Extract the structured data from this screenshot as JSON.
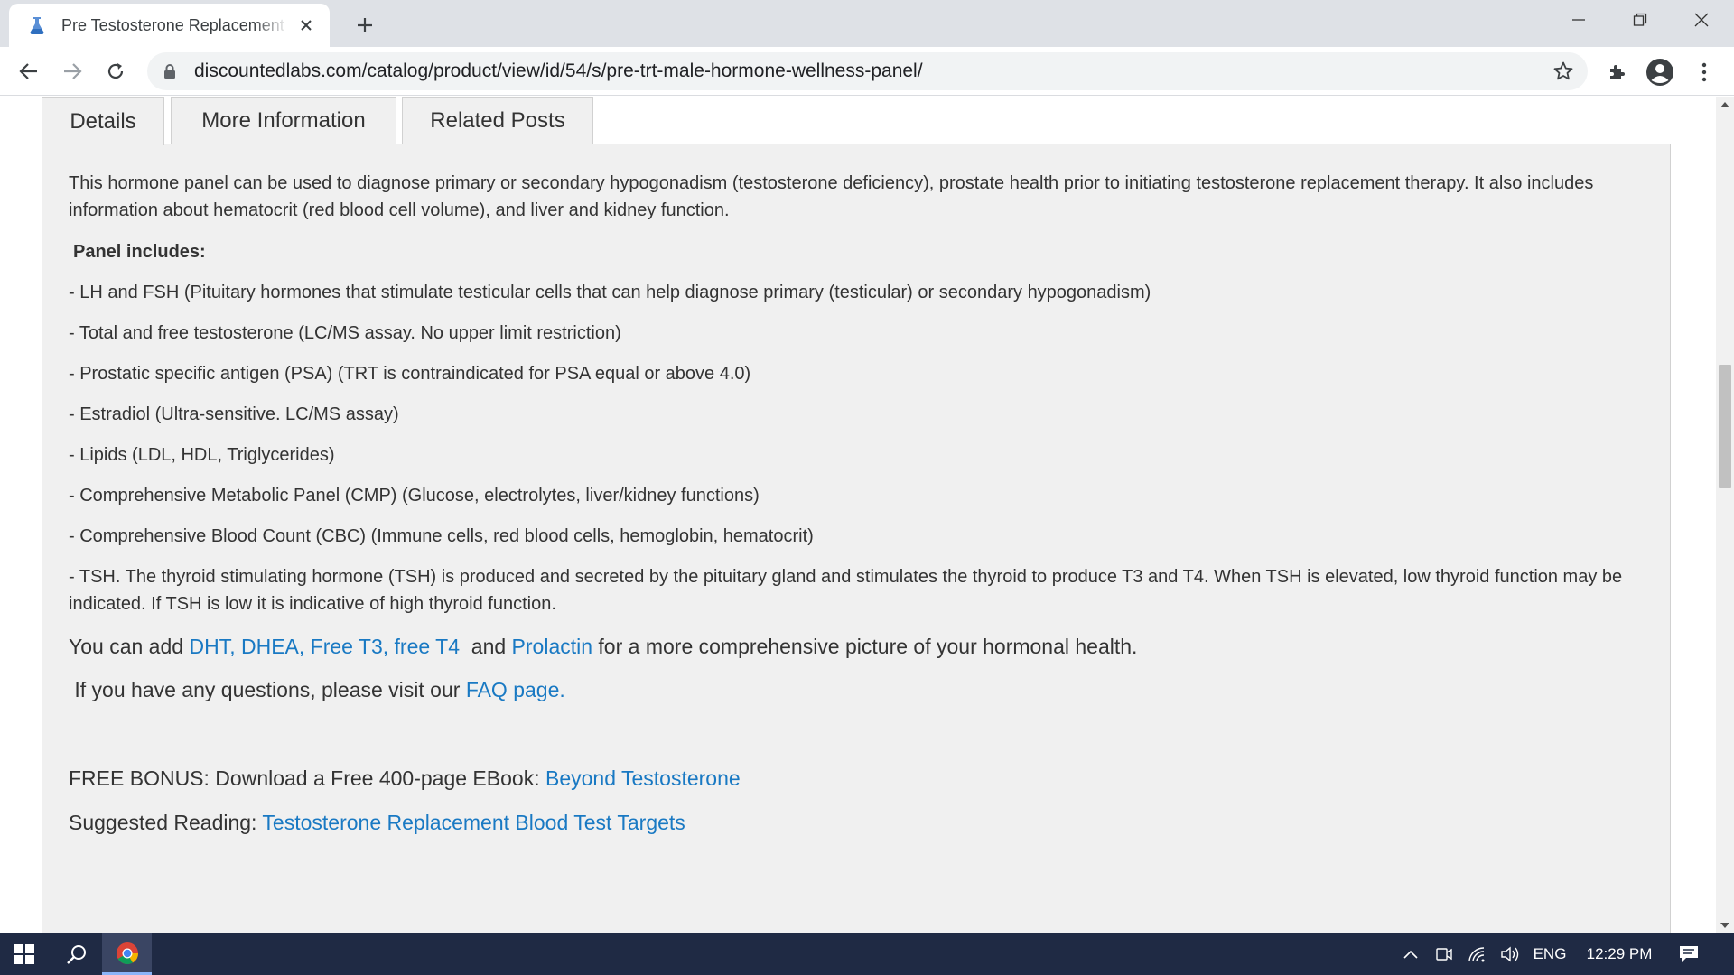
{
  "browser": {
    "tab_title": "Pre Testosterone Replacement Blood Test",
    "url": "discountedlabs.com/catalog/product/view/id/54/s/pre-trt-male-hormone-wellness-panel/"
  },
  "page_tabs": [
    {
      "label": "Details"
    },
    {
      "label": "More Information"
    },
    {
      "label": "Related Posts"
    }
  ],
  "content": {
    "intro": "This hormone panel can be used to diagnose primary or secondary hypogonadism (testosterone deficiency), prostate health prior to initiating testosterone replacement therapy. It also includes information about hematocrit (red blood cell volume), and liver and kidney function.",
    "panel_heading": "Panel includes:",
    "items": [
      " - LH and FSH (Pituitary hormones that stimulate testicular cells that can help diagnose primary (testicular) or secondary hypogonadism)",
      "  - Total and free testosterone (LC/MS assay.  No upper limit restriction)",
      "- Prostatic specific antigen (PSA) (TRT is contraindicated for PSA equal or above 4.0)",
      " - Estradiol (Ultra-sensitive. LC/MS assay)",
      " - Lipids (LDL, HDL, Triglycerides)",
      " - Comprehensive Metabolic Panel (CMP) (Glucose, electrolytes,  liver/kidney functions)",
      " - Comprehensive Blood Count (CBC) (Immune cells, red  blood cells, hemoglobin, hematocrit)",
      " - TSH. The thyroid stimulating hormone (TSH) is produced and secreted by the pituitary gland and stimulates the thyroid to produce T3 and T4. When TSH is elevated, low thyroid function may be indicated. If TSH is low it is indicative of high thyroid function."
    ],
    "add_prefix": "You can add ",
    "add_link_dht": "DHT",
    "add_sep1": ", ",
    "add_link_dhea": "DHEA",
    "add_sep2": ", ",
    "add_link_t3t4": "Free T3, free T4",
    "add_mid": "  and ",
    "add_link_prolactin": "Prolactin",
    "add_suffix": " for a more comprehensive picture of your hormonal health.",
    "faq_prefix": " If you have any questions, please visit our ",
    "faq_link": "FAQ page.",
    "bonus_prefix": "FREE BONUS: Download a Free 400-page EBook: ",
    "bonus_link": "Beyond Testosterone",
    "reading_prefix": "Suggested Reading: ",
    "reading_link": "Testosterone Replacement Blood Test Targets"
  },
  "taskbar": {
    "language": "ENG",
    "time": "12:29 PM"
  },
  "colors": {
    "link": "#1979c3",
    "taskbar": "#1f2a44",
    "content_bg": "#f0f0f0"
  }
}
